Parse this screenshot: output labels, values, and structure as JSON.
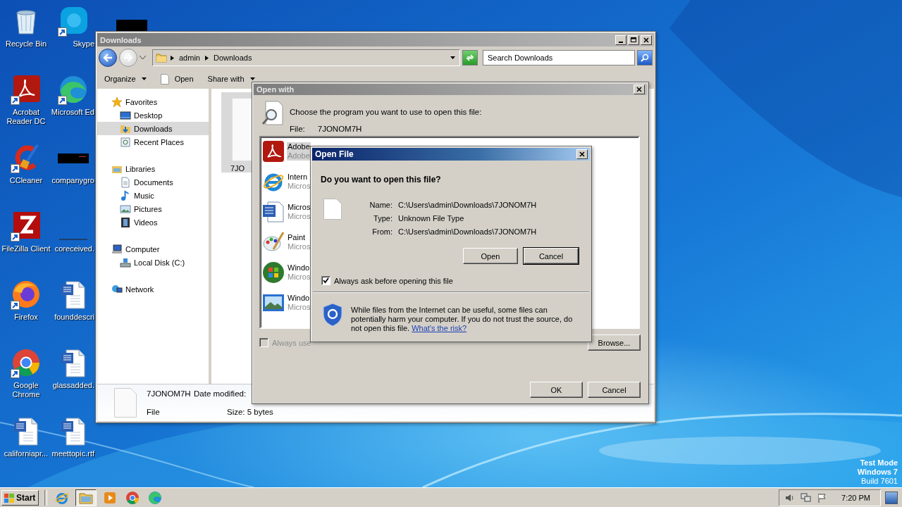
{
  "desktop_icons": [
    {
      "label": "Recycle Bin",
      "shortcut": false
    },
    {
      "label": "Skype",
      "shortcut": true
    },
    {
      "label": "Acrobat Reader DC",
      "shortcut": true
    },
    {
      "label": "Microsoft Ed",
      "shortcut": true
    },
    {
      "label": "CCleaner",
      "shortcut": true
    },
    {
      "label": "companygro",
      "shortcut": false
    },
    {
      "label": "FileZilla Client",
      "shortcut": true
    },
    {
      "label": "coreceived.",
      "shortcut": false
    },
    {
      "label": "Firefox",
      "shortcut": true
    },
    {
      "label": "founddescri",
      "shortcut": false
    },
    {
      "label": "Google Chrome",
      "shortcut": true
    },
    {
      "label": "glassadded.",
      "shortcut": false
    },
    {
      "label": "californiapr...",
      "shortcut": false
    },
    {
      "label": "meettopic.rtf",
      "shortcut": false
    }
  ],
  "explorer": {
    "title": "Downloads",
    "breadcrumb": [
      "admin",
      "Downloads"
    ],
    "search": {
      "placeholder": "Search Downloads"
    },
    "toolbar": [
      {
        "label": "Organize",
        "menu": true
      },
      {
        "label": "Open",
        "menu": false
      },
      {
        "label": "Share with",
        "menu": true
      }
    ],
    "navigation": [
      {
        "label": "Favorites",
        "selected": false,
        "children": [
          {
            "label": "Desktop",
            "selected": false
          },
          {
            "label": "Downloads",
            "selected": true
          },
          {
            "label": "Recent Places",
            "selected": false
          }
        ]
      },
      {
        "label": "Libraries",
        "selected": false,
        "children": [
          {
            "label": "Documents",
            "selected": false
          },
          {
            "label": "Music",
            "selected": false
          },
          {
            "label": "Pictures",
            "selected": false
          },
          {
            "label": "Videos",
            "selected": false
          }
        ]
      },
      {
        "label": "Computer",
        "selected": false,
        "children": [
          {
            "label": "Local Disk (C:)",
            "selected": false
          }
        ]
      },
      {
        "label": "Network",
        "selected": false
      }
    ],
    "files": [
      {
        "name": "7JO",
        "selected": true
      }
    ],
    "details": {
      "name": "7JONOM7H",
      "date_label": "Date modified:",
      "type": "File",
      "size": "Size: 5 bytes"
    }
  },
  "open_with": {
    "title": "Open with",
    "prompt": "Choose the program you want to use to open this file:",
    "file_label": "File:",
    "file_name": "7JONOM7H",
    "programs": [
      {
        "name": "Adobe",
        "publisher": "Adobe",
        "selected": true
      },
      {
        "name": "Intern",
        "publisher": "Micros",
        "selected": false
      },
      {
        "name": "Micros",
        "publisher": "Micros",
        "selected": false
      },
      {
        "name": "Paint",
        "publisher": "Micros",
        "selected": false
      },
      {
        "name": "Windo",
        "publisher": "Micros",
        "selected": false
      },
      {
        "name": "Windo",
        "publisher": "Micros",
        "selected": false
      }
    ],
    "always_use": {
      "label": "Always use",
      "checked": false,
      "disabled": true
    },
    "browse": "Browse...",
    "buttons": [
      "OK",
      "Cancel"
    ]
  },
  "open_file": {
    "title": "Open File",
    "question": "Do you want to open this file?",
    "fields": [
      {
        "label": "Name:",
        "value": "C:\\Users\\admin\\Downloads\\7JONOM7H"
      },
      {
        "label": "Type:",
        "value": "Unknown File Type"
      },
      {
        "label": "From:",
        "value": "C:\\Users\\admin\\Downloads\\7JONOM7H"
      }
    ],
    "buttons": [
      {
        "label": "Open",
        "default": false
      },
      {
        "label": "Cancel",
        "default": true
      }
    ],
    "always_ask": {
      "label": "Always ask before opening this file",
      "checked": true
    },
    "warning": "While files from the Internet can be useful, some files can potentially harm your computer. If you do not trust the source, do not open this file.",
    "risk_link": "What's the risk?"
  },
  "taskbar": {
    "start": "Start",
    "apps": [
      {
        "selected": false
      },
      {
        "selected": true
      },
      {
        "selected": false
      },
      {
        "selected": false
      },
      {
        "selected": false
      }
    ],
    "clock": "7:20 PM"
  },
  "desktop_notice": [
    "Test Mode",
    "Windows 7",
    "Build 7601"
  ]
}
